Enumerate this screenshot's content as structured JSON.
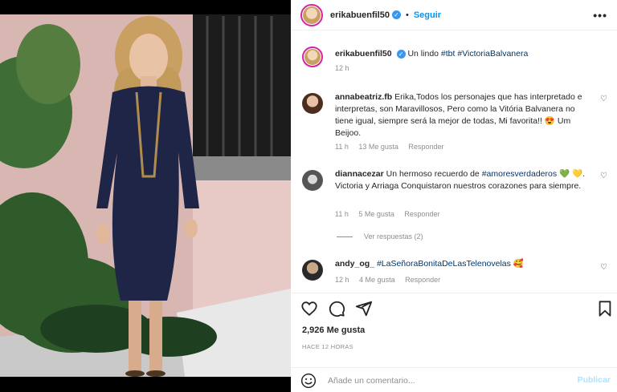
{
  "header": {
    "username": "erikabuenfil50",
    "separator": "•",
    "follow_label": "Seguir",
    "more_icon": "more-horizontal-icon"
  },
  "caption": {
    "username": "erikabuenfil50",
    "text": "Un lindo",
    "tags": "#tbt #VictoriaBalvanera",
    "time": "12 h"
  },
  "comments": [
    {
      "username": "annabeatriz.fb",
      "text": "Erika,Todos los personajes que has interpretado e interpretas, son Maravillosos, Pero como la Vitória Balvanera no tiene igual, siempre será la mejor de todas, Mi favorita!! 😍 Um Beijoo.",
      "time": "11 h",
      "likes": "13 Me gusta",
      "reply": "Responder"
    },
    {
      "username": "diannacezar",
      "text_before": "Un hermoso recuerdo de",
      "tag": "#amoresverdaderos",
      "text_after": "💚 💛. Victoria y Arriaga Conquistaron nuestros corazones para siempre.",
      "time": "11 h",
      "likes": "5 Me gusta",
      "reply": "Responder",
      "view_replies": "Ver respuestas (2)"
    },
    {
      "username": "andy_og_",
      "tag": "#LaSeñoraBonitaDeLasTelenovelas",
      "emoji": "🥰",
      "time": "12 h",
      "likes": "4 Me gusta",
      "reply": "Responder"
    }
  ],
  "footer": {
    "likes": "2,926 Me gusta",
    "ago": "HACE 12 HORAS",
    "comment_placeholder": "Añade un comentario...",
    "publish_label": "Publicar"
  },
  "colors": {
    "link_blue": "#0095f6",
    "hashtag": "#00376b",
    "muted": "#8e8e8e",
    "publish_disabled": "#b2dffc"
  }
}
